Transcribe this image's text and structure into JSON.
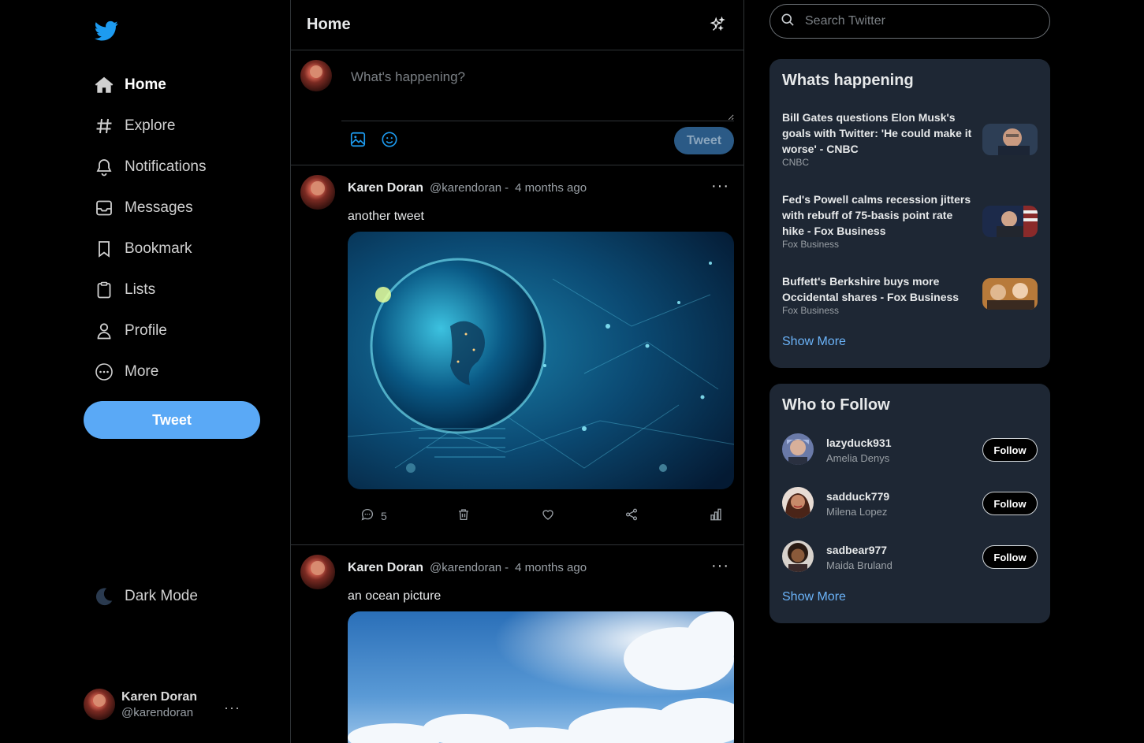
{
  "colors": {
    "accent": "#5aa9f6",
    "link": "#6bb3f8",
    "card": "#1e2734",
    "background": "#000000"
  },
  "sidebar": {
    "logo_icon": "twitter-bird-icon",
    "items": [
      {
        "label": "Home",
        "icon": "home-icon"
      },
      {
        "label": "Explore",
        "icon": "hashtag-icon"
      },
      {
        "label": "Notifications",
        "icon": "bell-icon"
      },
      {
        "label": "Messages",
        "icon": "inbox-icon"
      },
      {
        "label": "Bookmark",
        "icon": "bookmark-icon"
      },
      {
        "label": "Lists",
        "icon": "clipboard-icon"
      },
      {
        "label": "Profile",
        "icon": "user-icon"
      },
      {
        "label": "More",
        "icon": "more-circle-icon"
      }
    ],
    "tweet_button": "Tweet",
    "dark_mode_label": "Dark Mode",
    "account": {
      "name": "Karen Doran",
      "handle": "@karendoran",
      "menu": "···"
    }
  },
  "feed": {
    "title": "Home",
    "compose": {
      "placeholder": "What's happening?",
      "submit": "Tweet"
    },
    "tweets": [
      {
        "author": "Karen Doran",
        "handle": "@karendoran",
        "separator": "-",
        "time": "4 months ago",
        "text": "another tweet",
        "replies": "5",
        "more": "···"
      },
      {
        "author": "Karen Doran",
        "handle": "@karendoran",
        "separator": "-",
        "time": "4 months ago",
        "text": "an ocean picture",
        "more": "···"
      }
    ]
  },
  "search": {
    "placeholder": "Search Twitter"
  },
  "whats_happening": {
    "title": "Whats happening",
    "items": [
      {
        "title": "Bill Gates questions Elon Musk's goals with Twitter: 'He could make it worse' - CNBC",
        "source": "CNBC"
      },
      {
        "title": "Fed's Powell calms recession jitters with rebuff of 75-basis point rate hike - Fox Business",
        "source": "Fox Business"
      },
      {
        "title": "Buffett's Berkshire buys more Occidental shares - Fox Business",
        "source": "Fox Business"
      }
    ],
    "show_more": "Show More"
  },
  "who_to_follow": {
    "title": "Who to Follow",
    "users": [
      {
        "username": "lazyduck931",
        "name": "Amelia Denys",
        "button": "Follow"
      },
      {
        "username": "sadduck779",
        "name": "Milena Lopez",
        "button": "Follow"
      },
      {
        "username": "sadbear977",
        "name": "Maida Bruland",
        "button": "Follow"
      }
    ],
    "show_more": "Show More"
  }
}
